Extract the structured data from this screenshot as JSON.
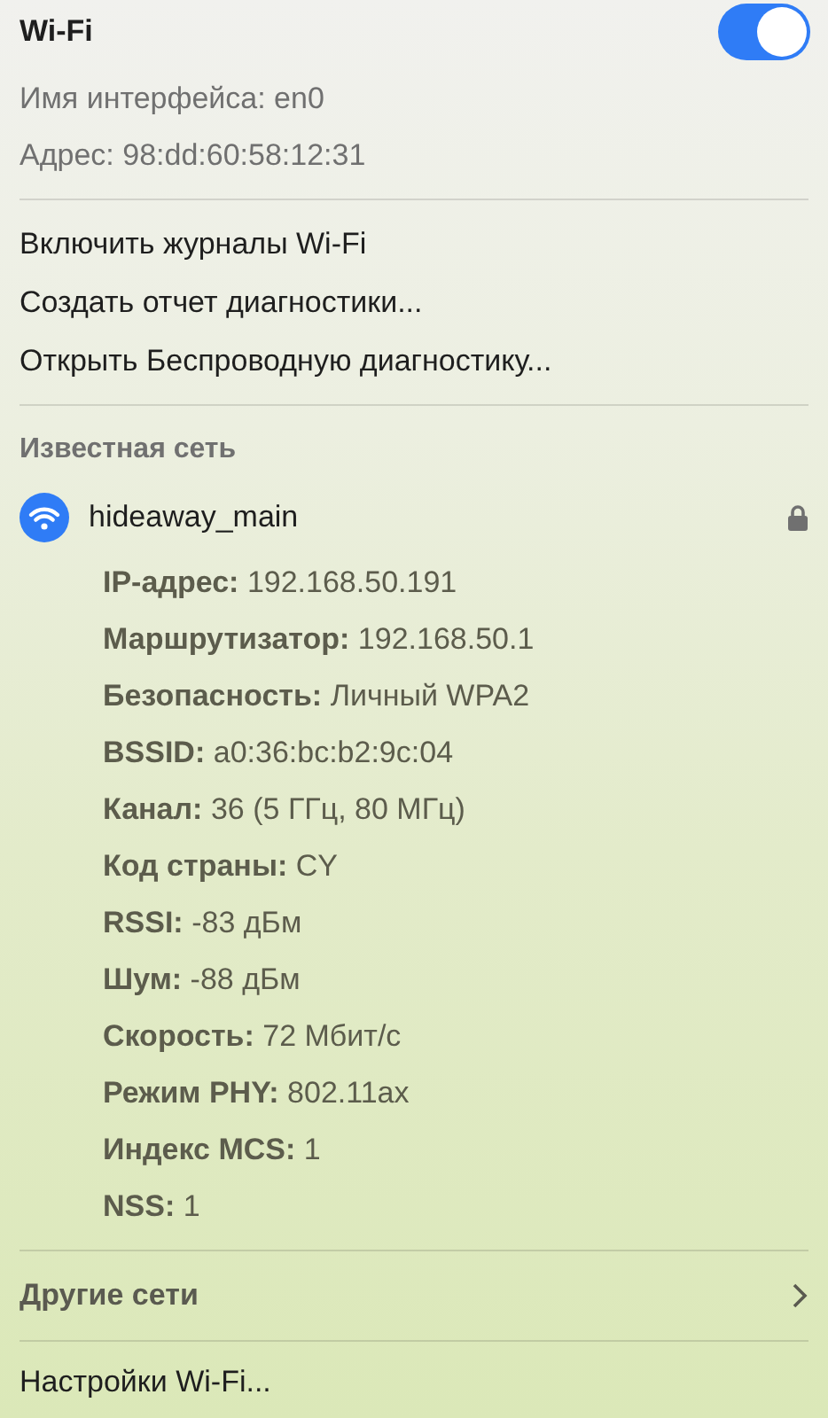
{
  "header": {
    "title": "Wi-Fi",
    "on": true
  },
  "info": [
    "Имя интерфейса: en0",
    "Адрес: 98:dd:60:58:12:31"
  ],
  "actions": [
    "Включить журналы Wi-Fi",
    "Создать отчет диагностики...",
    "Открыть Беспроводную диагностику..."
  ],
  "known_section": {
    "title": "Известная сеть",
    "network": {
      "name": "hideaway_main",
      "locked": true,
      "details": [
        {
          "label": "IP-адрес:",
          "value": "192.168.50.191"
        },
        {
          "label": "Маршрутизатор:",
          "value": "192.168.50.1"
        },
        {
          "label": "Безопасность:",
          "value": "Личный WPA2"
        },
        {
          "label": "BSSID:",
          "value": "a0:36:bc:b2:9c:04"
        },
        {
          "label": "Канал:",
          "value": "36 (5 ГГц, 80 МГц)"
        },
        {
          "label": "Код страны:",
          "value": "CY"
        },
        {
          "label": "RSSI:",
          "value": "-83 дБм"
        },
        {
          "label": "Шум:",
          "value": "-88 дБм"
        },
        {
          "label": "Скорость:",
          "value": "72 Мбит/с"
        },
        {
          "label": "Режим PHY:",
          "value": "802.11ax"
        },
        {
          "label": "Индекс MCS:",
          "value": "1"
        },
        {
          "label": "NSS:",
          "value": "1"
        }
      ]
    }
  },
  "other": {
    "label": "Другие сети",
    "expanded": false
  },
  "settings": "Настройки Wi-Fi..."
}
